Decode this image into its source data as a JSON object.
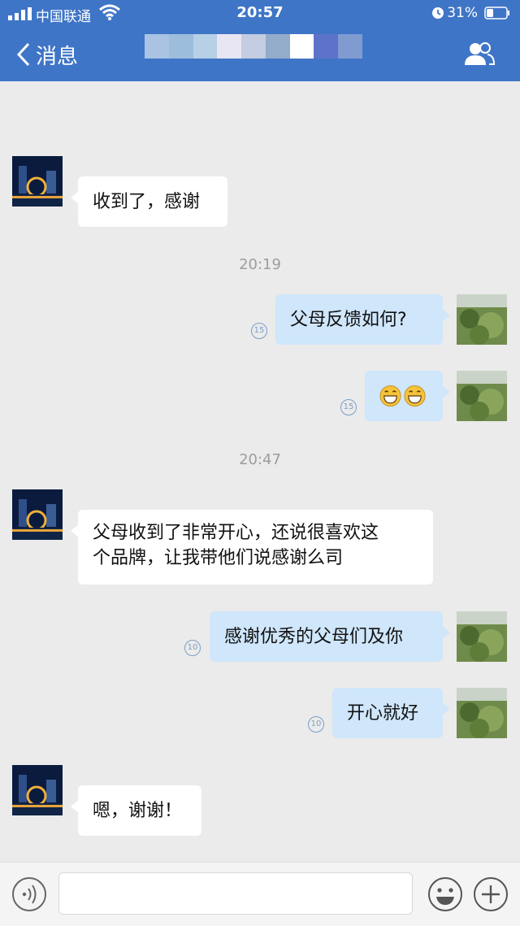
{
  "status_bar": {
    "carrier": "中国联通",
    "time": "20:57",
    "battery": "31%"
  },
  "nav": {
    "back_label": "消息",
    "title_mask_colors": [
      "#aac3e2",
      "#9dbddd",
      "#b7d0e6",
      "#e8e6f2",
      "#c3cce0",
      "#92acc9",
      "#ffffff",
      "#5d73c9",
      "#7f9bd0"
    ]
  },
  "messages": [
    {
      "side": "left",
      "text": "收到了，感谢"
    },
    {
      "type": "time",
      "text": "20:19"
    },
    {
      "side": "right",
      "text": "父母反馈如何?",
      "read_count": "15"
    },
    {
      "side": "right",
      "emoji": [
        "grin-emoji",
        "grin-emoji"
      ],
      "read_count": "15"
    },
    {
      "type": "time",
      "text": "20:47"
    },
    {
      "side": "left",
      "lines": [
        "父母收到了非常开心，还说很喜欢这",
        "个品牌，让我带他们说感谢么司"
      ]
    },
    {
      "side": "right",
      "text": "感谢优秀的父母们及你",
      "read_count": "10"
    },
    {
      "side": "right",
      "text": "开心就好",
      "read_count": "10"
    },
    {
      "side": "left",
      "text": "嗯，谢谢！"
    }
  ],
  "input": {
    "placeholder": ""
  },
  "colors": {
    "header": "#3f75c7",
    "background": "#ebebeb",
    "bubble_sent": "#cfe6fb",
    "bubble_received": "#ffffff"
  }
}
